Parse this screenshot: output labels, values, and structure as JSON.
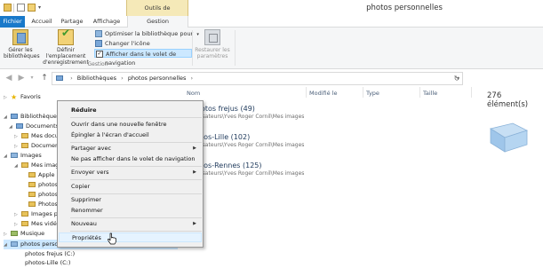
{
  "window": {
    "title": "photos personnelles"
  },
  "ribbon_tabs": {
    "fichier": "Fichier",
    "accueil": "Accueil",
    "partage": "Partage",
    "affichage": "Affichage",
    "contextual_group": "Outils de bibliothèque",
    "gestion": "Gestion"
  },
  "ribbon": {
    "gerer": "Gérer les bibliothèques",
    "definir": "Définir l'emplacement d'enregistrement",
    "optimiser": "Optimiser la bibliothèque pour",
    "changer_icone": "Changer l'icône",
    "afficher_volet": "Afficher dans le volet de navigation",
    "restaurer": "Restaurer les paramètres",
    "group_label": "Gestion"
  },
  "address": {
    "crumbs": [
      "Bibliothèques",
      "photos personnelles"
    ]
  },
  "nav_tree": [
    {
      "label": "Favoris",
      "icon": "star-icon"
    },
    {
      "label": "Bibliothèques",
      "icon": "library-icon"
    },
    {
      "label": "Documents",
      "icon": "library-icon"
    },
    {
      "label": "Mes docum",
      "icon": "folder-icon"
    },
    {
      "label": "Document",
      "icon": "folder-icon"
    },
    {
      "label": "Images",
      "icon": "library-icon"
    },
    {
      "label": "Mes imag",
      "icon": "folder-icon"
    },
    {
      "label": "Apple Ex",
      "icon": "folder-icon"
    },
    {
      "label": "photos f",
      "icon": "folder-icon"
    },
    {
      "label": "photos-L",
      "icon": "folder-icon"
    },
    {
      "label": "Photos-R",
      "icon": "folder-icon"
    },
    {
      "label": "Images pu",
      "icon": "folder-icon"
    },
    {
      "label": "Mes vidéo",
      "icon": "folder-icon"
    },
    {
      "label": "Musique",
      "icon": "music-icon"
    },
    {
      "label": "photos personnelles",
      "icon": "image-library-icon"
    },
    {
      "label": "photos frejus (C:)",
      "icon": "folder-icon"
    },
    {
      "label": "photos-Lille (C:)",
      "icon": "folder-icon"
    }
  ],
  "columns": {
    "nom": "Nom",
    "modifie": "Modifié le",
    "type": "Type",
    "taille": "Taille"
  },
  "item_count": "276 élément(s)",
  "groups": [
    {
      "name": "otos frejus (49)",
      "path": "isateurs\\Yves Roger Cornil\\Mes images"
    },
    {
      "name": "tos-Lille (102)",
      "path": "isateurs\\Yves Roger Cornil\\Mes images"
    },
    {
      "name": "tos-Rennes (125)",
      "path": "isateurs\\Yves Roger Cornil\\Mes images"
    }
  ],
  "context_menu": [
    {
      "label": "Réduire",
      "bold": true
    },
    {
      "label": "Ouvrir dans une nouvelle fenêtre"
    },
    {
      "label": "Épingler à l'écran d'accueil"
    },
    {
      "label": "Partager avec",
      "submenu": "▶"
    },
    {
      "label": "Ne pas afficher dans le volet de navigation"
    },
    {
      "label": "Envoyer vers",
      "submenu": "▶"
    },
    {
      "label": "Copier"
    },
    {
      "label": "Supprimer"
    },
    {
      "label": "Renommer"
    },
    {
      "label": "Nouveau",
      "submenu": "▶"
    },
    {
      "label": "Propriétés"
    }
  ],
  "colors": {
    "accent": "#1979ca",
    "selection": "#cce8ff",
    "contextual_tab": "#f5e9b8"
  }
}
